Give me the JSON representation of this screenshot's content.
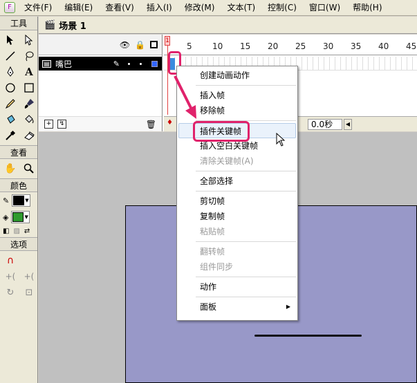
{
  "menubar": {
    "items": [
      "文件(F)",
      "编辑(E)",
      "查看(V)",
      "插入(I)",
      "修改(M)",
      "文本(T)",
      "控制(C)",
      "窗口(W)",
      "帮助(H)"
    ]
  },
  "toolbox": {
    "sections": {
      "tools": "工具",
      "view": "查看",
      "colors": "颜色",
      "options": "选项"
    },
    "stroke_color": "#000000",
    "fill_color": "#2e9a2e"
  },
  "scene": {
    "label": "场景 1"
  },
  "timeline": {
    "ruler_numbers": [
      "1",
      "5",
      "10",
      "15",
      "20",
      "25",
      "30",
      "35",
      "40",
      "45"
    ],
    "layer": {
      "name": "嘴巴",
      "outline_color": "#3366ff"
    },
    "status": {
      "time": "0.0秒"
    }
  },
  "context_menu": {
    "items": [
      {
        "label": "创建动画动作",
        "disabled": false
      },
      {
        "sep": true
      },
      {
        "label": "插入帧",
        "disabled": false
      },
      {
        "label": "移除帧",
        "disabled": false
      },
      {
        "sep": true
      },
      {
        "label": "插件关键帧",
        "disabled": false,
        "hover": true
      },
      {
        "label": "插入空白关键帧",
        "disabled": false
      },
      {
        "label": "清除关键帧(A)",
        "disabled": true
      },
      {
        "sep": true
      },
      {
        "label": "全部选择",
        "disabled": false
      },
      {
        "sep": true
      },
      {
        "label": "剪切帧",
        "disabled": false
      },
      {
        "label": "复制帧",
        "disabled": false
      },
      {
        "label": "粘贴帧",
        "disabled": true
      },
      {
        "sep": true
      },
      {
        "label": "翻转帧",
        "disabled": true
      },
      {
        "label": "组件同步",
        "disabled": true
      },
      {
        "sep": true
      },
      {
        "label": "动作",
        "disabled": false
      },
      {
        "sep": true
      },
      {
        "label": "面板",
        "disabled": false,
        "submenu": true
      }
    ]
  },
  "stage": {
    "background": "#9898c8",
    "pasteboard": "#c0c0c0"
  },
  "annotation": {
    "color": "#e0226b"
  }
}
